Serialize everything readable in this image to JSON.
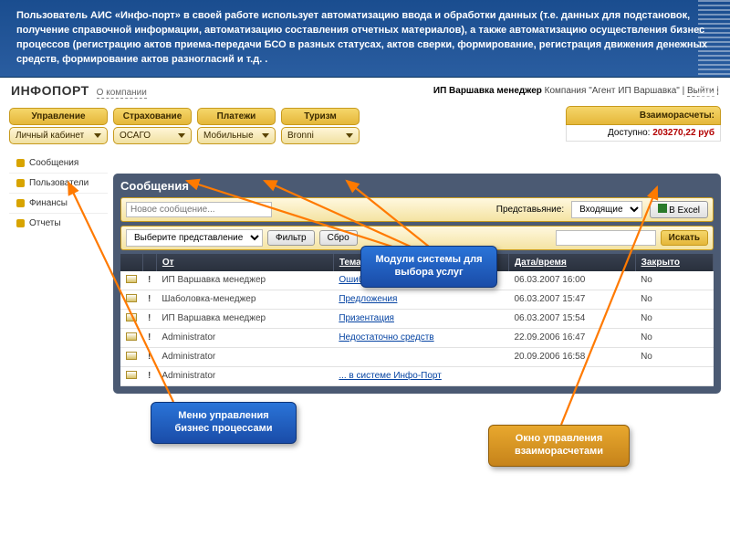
{
  "banner": "Пользователь АИС «Инфо-порт» в своей работе использует автоматизацию ввода и обработки данных (т.е. данных для подстановок, получение справочной информации, автоматизацию составления отчетных материалов), а также автоматизацию осуществления бизнес процессов (регистрацию актов приема-передачи БСО в разных статусах, актов сверки, формирование, регистрация движения денежных средств, формирование актов разногласий и т.д. .",
  "header": {
    "brand": "ИНФОПОРТ",
    "about": "О компании",
    "user_label": "ИП Варшавка менеджер",
    "company_label": "Компания",
    "company": "\"Агент ИП Варшавка\"",
    "logout": "Выйти"
  },
  "nav": {
    "manage_head": "Управление",
    "manage_sub": "Личный кабинет",
    "modules": [
      {
        "head": "Страхование",
        "sub": "ОСАГО"
      },
      {
        "head": "Платежи",
        "sub": "Мобильные"
      },
      {
        "head": "Туризм",
        "sub": "Bronni"
      }
    ]
  },
  "balance": {
    "title": "Взаиморасчеты:",
    "avail_label": "Доступно:",
    "amount": "203270,22 руб"
  },
  "side": [
    "Сообщения",
    "Пользователи",
    "Финансы",
    "Отчеты"
  ],
  "panel": {
    "title": "Сообщения",
    "new_placeholder": "Новое сообщение...",
    "view_label": "Представьяние:",
    "view_value": "Входящие",
    "excel": "В Excel",
    "select_placeholder": "Выберите представление",
    "filter": "Фильтр",
    "reset": "Сбро",
    "search": "Искать",
    "cols": {
      "from": "От",
      "subject": "Тема",
      "date": "Дата/время",
      "closed": "Закрыто"
    },
    "rows": [
      {
        "from": "ИП Варшавка менеджер",
        "subj": "Ошибки",
        "date": "06.03.2007 16:00",
        "closed": "No"
      },
      {
        "from": "Шаболовка-менеджер",
        "subj": "Предложения",
        "date": "06.03.2007 15:47",
        "closed": "No"
      },
      {
        "from": "ИП Варшавка менеджер",
        "subj": "Призентация",
        "date": "06.03.2007 15:54",
        "closed": "No"
      },
      {
        "from": "Administrator",
        "subj": "Недостаточно средств",
        "date": "22.09.2006 16:47",
        "closed": "No"
      },
      {
        "from": "Administrator",
        "subj": "",
        "date": "20.09.2006 16:58",
        "closed": "No"
      },
      {
        "from": "Administrator",
        "subj": "... в системе Инфо-Порт",
        "date": "",
        "closed": ""
      }
    ]
  },
  "callouts": {
    "c1": "Модули системы\nдля выбора услуг",
    "c2": "Меню управления\nбизнес процессами",
    "c3": "Окно управления\nвзаиморасчетами"
  }
}
